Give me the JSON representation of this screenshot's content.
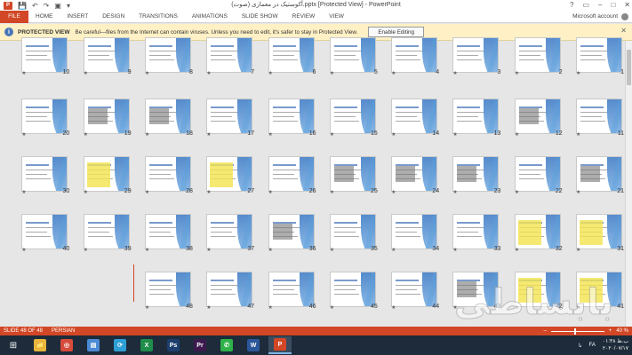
{
  "window": {
    "title": "آکوستیک در معماری (صوت).pptx [Protected View] - PowerPoint",
    "app_icon_label": "P",
    "controls": {
      "help": "?",
      "ribbon_display": "▭",
      "minimize": "–",
      "maximize": "□",
      "close": "✕"
    }
  },
  "quick_access": {
    "save": "💾",
    "undo": "↶",
    "redo": "↷",
    "start_from_beginning": "▣",
    "customize": "▾"
  },
  "ribbon": {
    "file_tab": "FILE",
    "tabs": [
      "HOME",
      "INSERT",
      "DESIGN",
      "TRANSITIONS",
      "ANIMATIONS",
      "SLIDE SHOW",
      "REVIEW",
      "VIEW"
    ],
    "account": "Microsoft account"
  },
  "protected_bar": {
    "title": "PROTECTED VIEW",
    "message": "Be careful—files from the Internet can contain viruses. Unless you need to edit, it's safer to stay in Protected View.",
    "button": "Enable Editing",
    "close": "✕"
  },
  "slides": [
    {
      "num": "1",
      "kind": "text"
    },
    {
      "num": "2",
      "kind": "text"
    },
    {
      "num": "3",
      "kind": "text"
    },
    {
      "num": "4",
      "kind": "text"
    },
    {
      "num": "5",
      "kind": "text"
    },
    {
      "num": "6",
      "kind": "text"
    },
    {
      "num": "7",
      "kind": "text"
    },
    {
      "num": "8",
      "kind": "text"
    },
    {
      "num": "9",
      "kind": "text"
    },
    {
      "num": "10",
      "kind": "text"
    },
    {
      "num": "11",
      "kind": "text"
    },
    {
      "num": "12",
      "kind": "img"
    },
    {
      "num": "13",
      "kind": "text"
    },
    {
      "num": "14",
      "kind": "text"
    },
    {
      "num": "15",
      "kind": "text"
    },
    {
      "num": "16",
      "kind": "text"
    },
    {
      "num": "17",
      "kind": "text"
    },
    {
      "num": "18",
      "kind": "img"
    },
    {
      "num": "19",
      "kind": "img"
    },
    {
      "num": "20",
      "kind": "text"
    },
    {
      "num": "21",
      "kind": "img"
    },
    {
      "num": "22",
      "kind": "text"
    },
    {
      "num": "23",
      "kind": "img"
    },
    {
      "num": "24",
      "kind": "img"
    },
    {
      "num": "25",
      "kind": "img"
    },
    {
      "num": "26",
      "kind": "text"
    },
    {
      "num": "27",
      "kind": "yel"
    },
    {
      "num": "28",
      "kind": "text"
    },
    {
      "num": "29",
      "kind": "yel"
    },
    {
      "num": "30",
      "kind": "text"
    },
    {
      "num": "31",
      "kind": "yel"
    },
    {
      "num": "32",
      "kind": "yel"
    },
    {
      "num": "33",
      "kind": "text"
    },
    {
      "num": "34",
      "kind": "text"
    },
    {
      "num": "35",
      "kind": "text"
    },
    {
      "num": "36",
      "kind": "img"
    },
    {
      "num": "37",
      "kind": "text"
    },
    {
      "num": "38",
      "kind": "text"
    },
    {
      "num": "39",
      "kind": "text"
    },
    {
      "num": "40",
      "kind": "text"
    },
    {
      "num": "41",
      "kind": "yel"
    },
    {
      "num": "42",
      "kind": "yel"
    },
    {
      "num": "43",
      "kind": "img"
    },
    {
      "num": "44",
      "kind": "text"
    },
    {
      "num": "45",
      "kind": "text"
    },
    {
      "num": "46",
      "kind": "text"
    },
    {
      "num": "47",
      "kind": "text"
    },
    {
      "num": "48",
      "kind": "text"
    }
  ],
  "star_glyph": "★",
  "status_bar": {
    "slide_info": "SLIDE 48 OF 48",
    "language": "PERSIAN",
    "zoom": "40 %",
    "zoom_minus": "–",
    "zoom_plus": "+"
  },
  "taskbar": {
    "start": "⊞",
    "apps": [
      {
        "name": "file-explorer",
        "label": "📁",
        "color": "#e9b53a"
      },
      {
        "name": "chrome",
        "label": "◎",
        "color": "#d64b3a"
      },
      {
        "name": "device-manager",
        "label": "▤",
        "color": "#4b8bd6"
      },
      {
        "name": "sync",
        "label": "⟳",
        "color": "#2d9fd6"
      },
      {
        "name": "excel",
        "label": "X",
        "color": "#1f8e4b"
      },
      {
        "name": "photoshop",
        "label": "Ps",
        "color": "#1c3f6e"
      },
      {
        "name": "premiere",
        "label": "Pr",
        "color": "#3c1a4e"
      },
      {
        "name": "whatsapp",
        "label": "✆",
        "color": "#2fb24a"
      },
      {
        "name": "word",
        "label": "W",
        "color": "#2b579a"
      },
      {
        "name": "powerpoint",
        "label": "P",
        "color": "#d24726"
      }
    ],
    "tray_lang": "FA",
    "tray_label": "نا",
    "time": "۰۱:۳۸ ب.ظ",
    "date": "۲۰۲۰/۰۷/۱۷"
  },
  "watermark": "بابساطی"
}
